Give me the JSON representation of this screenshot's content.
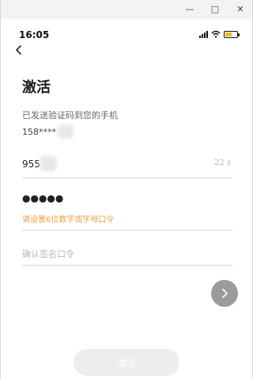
{
  "window": {
    "minimize_glyph": "—",
    "maximize_glyph": "□",
    "close_glyph": "✕"
  },
  "status_bar": {
    "time": "16:05",
    "battery_color": "#f2b824"
  },
  "page": {
    "back_icon": "chevron-left-icon",
    "title": "激活",
    "hint": "已发送验证码到您的手机",
    "phone": "158****"
  },
  "form": {
    "code_value": "955",
    "countdown": "22 s",
    "password_mask": "●●●●●",
    "password_warning": "请设置6位数字或字母口令",
    "confirm_placeholder": "确认签名口令",
    "warning_color": "#f0a040"
  },
  "actions": {
    "next_icon": "chevron-right-icon",
    "activate_label": "激活"
  }
}
